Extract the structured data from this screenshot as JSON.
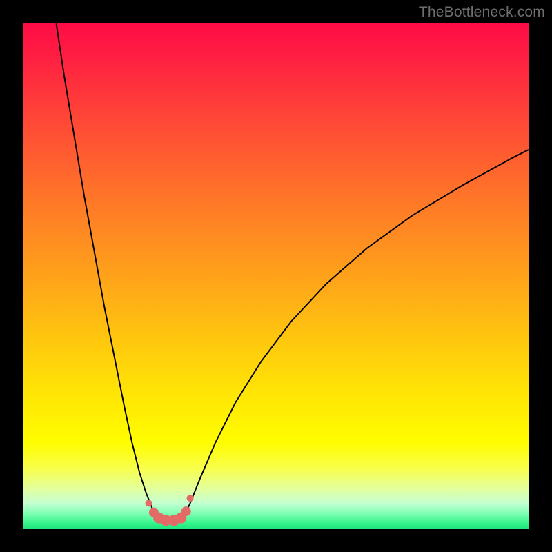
{
  "watermark": "TheBottleneck.com",
  "colors": {
    "curve_stroke": "#000000",
    "marker_fill": "#e46a68",
    "marker_stroke": "#d75a58",
    "gradient_top": "#ff0b46",
    "gradient_bottom": "#22e47d",
    "frame": "#000000"
  },
  "chart_data": {
    "type": "line",
    "title": "",
    "xlabel": "",
    "ylabel": "",
    "xlim": [
      0,
      100
    ],
    "ylim": [
      0,
      100
    ],
    "grid": false,
    "legend": false,
    "annotations": [],
    "series": [
      {
        "name": "left-branch",
        "x": [
          6.5,
          8,
          10,
          12,
          14,
          16,
          18,
          20,
          21.5,
          23,
          24.3,
          25.5,
          26.2
        ],
        "y": [
          100,
          90,
          78,
          66,
          55,
          44,
          34,
          24,
          17,
          11,
          7,
          4,
          2.4
        ]
      },
      {
        "name": "valley-floor",
        "x": [
          26.2,
          27.5,
          29,
          30.5,
          31.8
        ],
        "y": [
          2.4,
          1.6,
          1.4,
          1.6,
          2.4
        ]
      },
      {
        "name": "right-branch",
        "x": [
          31.8,
          33,
          35,
          38,
          42,
          47,
          53,
          60,
          68,
          77,
          87,
          97,
          100
        ],
        "y": [
          2.4,
          5,
          10,
          17,
          25,
          33,
          41,
          48.5,
          55.5,
          62,
          68,
          73.5,
          75
        ]
      }
    ],
    "markers": {
      "name": "valley-points",
      "x": [
        24.8,
        25.8,
        26.8,
        28.2,
        29.8,
        31.2,
        32.2,
        33.0
      ],
      "y": [
        5.0,
        3.2,
        2.1,
        1.6,
        1.6,
        2.1,
        3.4,
        6.0
      ],
      "r": [
        5,
        7,
        8,
        8,
        8,
        8,
        7,
        5
      ]
    }
  }
}
